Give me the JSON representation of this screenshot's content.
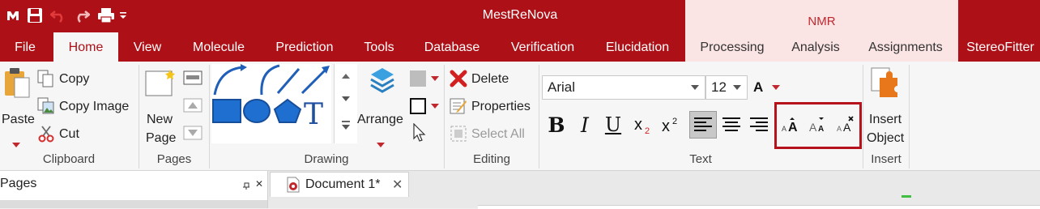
{
  "app": {
    "title": "MestReNova"
  },
  "context_group": {
    "label": "NMR"
  },
  "quick_access": [
    "app-logo",
    "save-icon",
    "undo-icon",
    "redo-icon",
    "print-icon",
    "customize-qat-icon"
  ],
  "tabs": {
    "file": "File",
    "home": "Home",
    "view": "View",
    "molecule": "Molecule",
    "prediction": "Prediction",
    "tools": "Tools",
    "database": "Database",
    "verification": "Verification",
    "elucidation": "Elucidation",
    "processing": "Processing",
    "analysis": "Analysis",
    "assignments": "Assignments",
    "stereofitter": "StereoFitter"
  },
  "ribbon": {
    "clipboard": {
      "paste": "Paste",
      "copy": "Copy",
      "copy_image": "Copy Image",
      "cut": "Cut",
      "group": "Clipboard"
    },
    "pages": {
      "new_page_1": "New",
      "new_page_2": "Page",
      "group": "Pages"
    },
    "drawing": {
      "arrange": "Arrange",
      "group": "Drawing"
    },
    "editing": {
      "delete": "Delete",
      "properties": "Properties",
      "select_all": "Select All",
      "group": "Editing"
    },
    "text": {
      "font": "Arial",
      "size": "12",
      "group": "Text"
    },
    "insert": {
      "insert_1": "Insert",
      "insert_2": "Object",
      "group": "Insert"
    }
  },
  "panes": {
    "pages_title": "Pages"
  },
  "document_tab": {
    "title": "Document 1*"
  },
  "colors": {
    "brand_red": "#ad1016",
    "context_bg": "#fbe4e4",
    "highlight_box": "#b5121b",
    "shape_blue": "#1f6fd1"
  }
}
